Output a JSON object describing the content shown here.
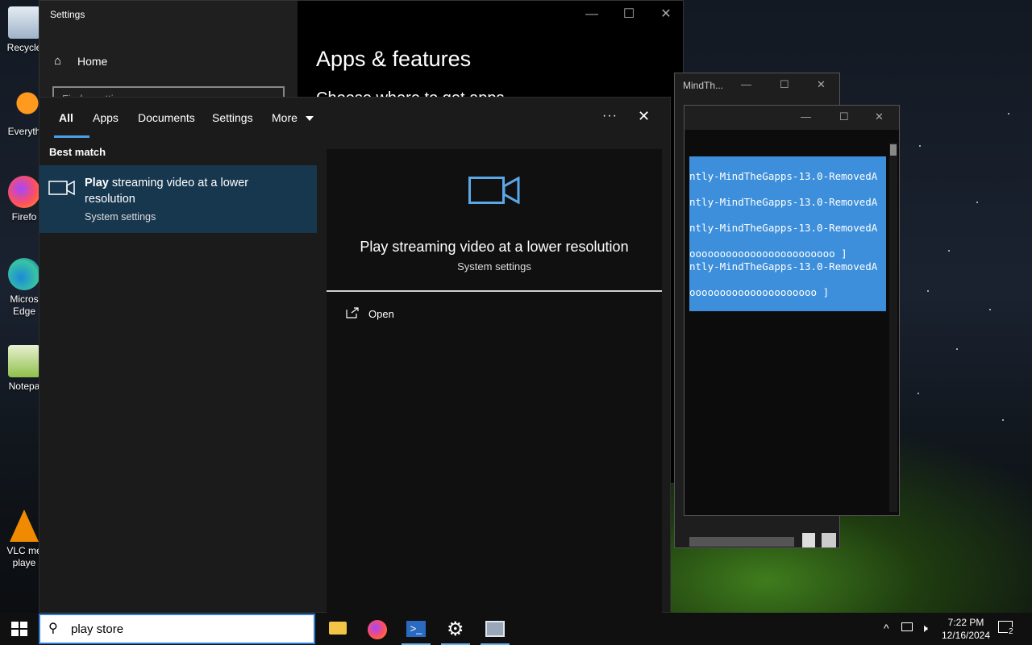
{
  "desktop": {
    "icons": [
      {
        "label": "Recycle",
        "icon": "recycle-bin-icon"
      },
      {
        "label": "Everyth",
        "icon": "everything-search-icon"
      },
      {
        "label": "Firefo",
        "icon": "firefox-icon"
      },
      {
        "label": "Micros Edge",
        "icon": "edge-icon"
      },
      {
        "label": "Notepa",
        "icon": "notepad-plus-icon"
      },
      {
        "label": "VLC me playe",
        "icon": "vlc-icon"
      }
    ]
  },
  "settings_window": {
    "title": "Settings",
    "home_label": "Home",
    "find_placeholder": "Find a setting",
    "page_heading": "Apps & features",
    "subheading": "Choose where to get apps",
    "controls": {
      "minimize": "—",
      "maximize": "☐",
      "close": "✕"
    }
  },
  "terminal_back": {
    "title": "MindTh...",
    "controls": {
      "minimize": "—",
      "maximize": "☐",
      "close": "✕"
    }
  },
  "terminal": {
    "controls": {
      "minimize": "—",
      "maximize": "☐",
      "close": "✕"
    },
    "lines": [
      "ntly-MindTheGapps-13.0-RemovedA",
      "ntly-MindTheGapps-13.0-RemovedA",
      "ntly-MindTheGapps-13.0-RemovedA",
      "oooooooooooooooooooooooo  ]",
      "ntly-MindTheGapps-13.0-RemovedA",
      "ooooooooooooooooooooo   ]"
    ]
  },
  "search": {
    "tabs": [
      {
        "label": "All",
        "active": true
      },
      {
        "label": "Apps",
        "active": false
      },
      {
        "label": "Documents",
        "active": false
      },
      {
        "label": "Settings",
        "active": false
      },
      {
        "label": "More",
        "active": false
      }
    ],
    "more_icon": "caret-down-icon",
    "ellipsis": "···",
    "close": "✕",
    "best_match_heading": "Best match",
    "result": {
      "title_bold": "Play",
      "title_rest": " streaming video at a lower resolution",
      "subtitle": "System settings",
      "icon": "video-camera-icon"
    },
    "preview": {
      "title": "Play streaming video at a lower resolution",
      "subtitle": "System settings",
      "action_label": "Open",
      "action_icon": "open-external-icon"
    },
    "query": "play store"
  },
  "taskbar": {
    "apps": [
      {
        "name": "file-explorer",
        "icon": "folder-icon",
        "color": "#f3c546"
      },
      {
        "name": "firefox",
        "icon": "firefox-icon",
        "color": "#ff7139"
      },
      {
        "name": "powershell",
        "icon": "powershell-icon",
        "color": "#2a6bc2"
      },
      {
        "name": "settings",
        "icon": "gear-icon",
        "color": "#ffffff"
      },
      {
        "name": "remote-desktop",
        "icon": "remote-desktop-icon",
        "color": "#9aa7b8"
      }
    ],
    "time": "7:22 PM",
    "date": "12/16/2024",
    "notification_count": "2"
  },
  "colors": {
    "accent": "#4aa0e6",
    "selection": "#17374f",
    "terminal_selection": "#3d8fdb"
  }
}
